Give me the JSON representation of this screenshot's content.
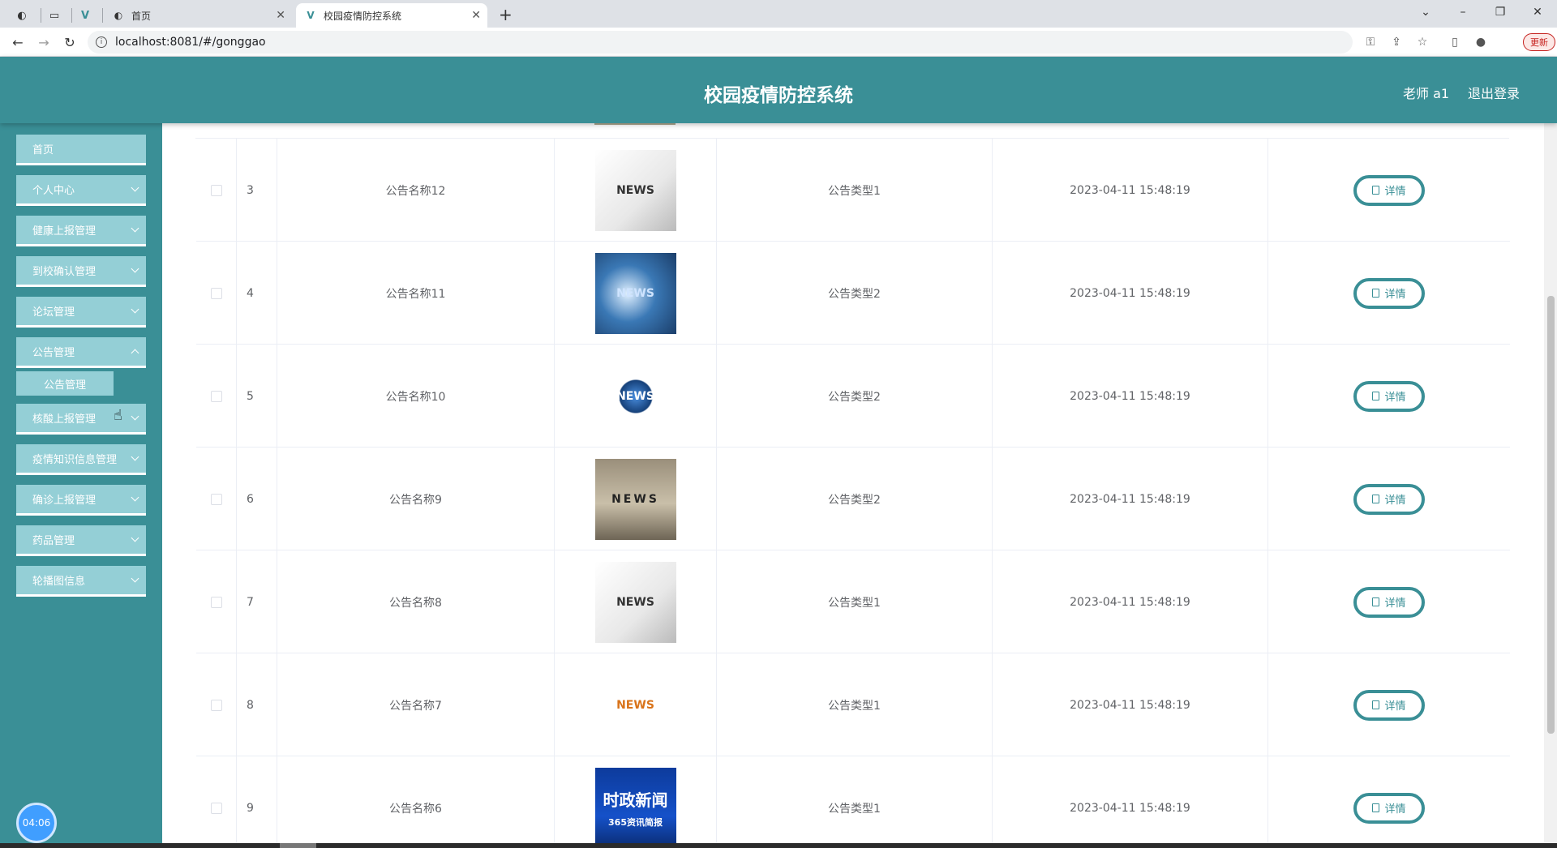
{
  "browser": {
    "tabs": [
      {
        "title": "首页",
        "active": false
      },
      {
        "title": "校园疫情防控系统",
        "active": true
      }
    ],
    "url": "localhost:8081/#/gonggao",
    "update_label": "更新"
  },
  "header": {
    "title": "校园疫情防控系统",
    "user": "老师 a1",
    "logout": "退出登录"
  },
  "sidebar": {
    "items": [
      {
        "label": "首页"
      },
      {
        "label": "个人中心"
      },
      {
        "label": "健康上报管理"
      },
      {
        "label": "到校确认管理"
      },
      {
        "label": "论坛管理"
      },
      {
        "label": "公告管理"
      },
      {
        "label": "核酸上报管理"
      },
      {
        "label": "疫情知识信息管理"
      },
      {
        "label": "确诊上报管理"
      },
      {
        "label": "药品管理"
      },
      {
        "label": "轮播图信息"
      }
    ],
    "submenu": "公告管理",
    "clock": "04:06"
  },
  "table": {
    "detail_label": "详情",
    "rows": [
      {
        "index": "3",
        "name": "公告名称12",
        "type": "公告类型1",
        "time": "2023-04-11 15:48:19",
        "image": "news-magnifier"
      },
      {
        "index": "4",
        "name": "公告名称11",
        "type": "公告类型2",
        "time": "2023-04-11 15:48:19",
        "image": "news-blue"
      },
      {
        "index": "5",
        "name": "公告名称10",
        "type": "公告类型2",
        "time": "2023-04-11 15:48:19",
        "image": "news-globe"
      },
      {
        "index": "6",
        "name": "公告名称9",
        "type": "公告类型2",
        "time": "2023-04-11 15:48:19",
        "image": "news-blocks"
      },
      {
        "index": "7",
        "name": "公告名称8",
        "type": "公告类型1",
        "time": "2023-04-11 15:48:19",
        "image": "news-magnifier"
      },
      {
        "index": "8",
        "name": "公告名称7",
        "type": "公告类型1",
        "time": "2023-04-11 15:48:19",
        "image": "news-figure"
      },
      {
        "index": "9",
        "name": "公告名称6",
        "type": "公告类型1",
        "time": "2023-04-11 15:48:19",
        "image": "news-chinese"
      }
    ]
  },
  "thumb_text": {
    "news": "NEWS",
    "chinese": "时政新闻",
    "chinese_sub": "365资讯简报"
  },
  "colors": {
    "teal": "#3a8f96",
    "menu": "#94cfd6"
  }
}
